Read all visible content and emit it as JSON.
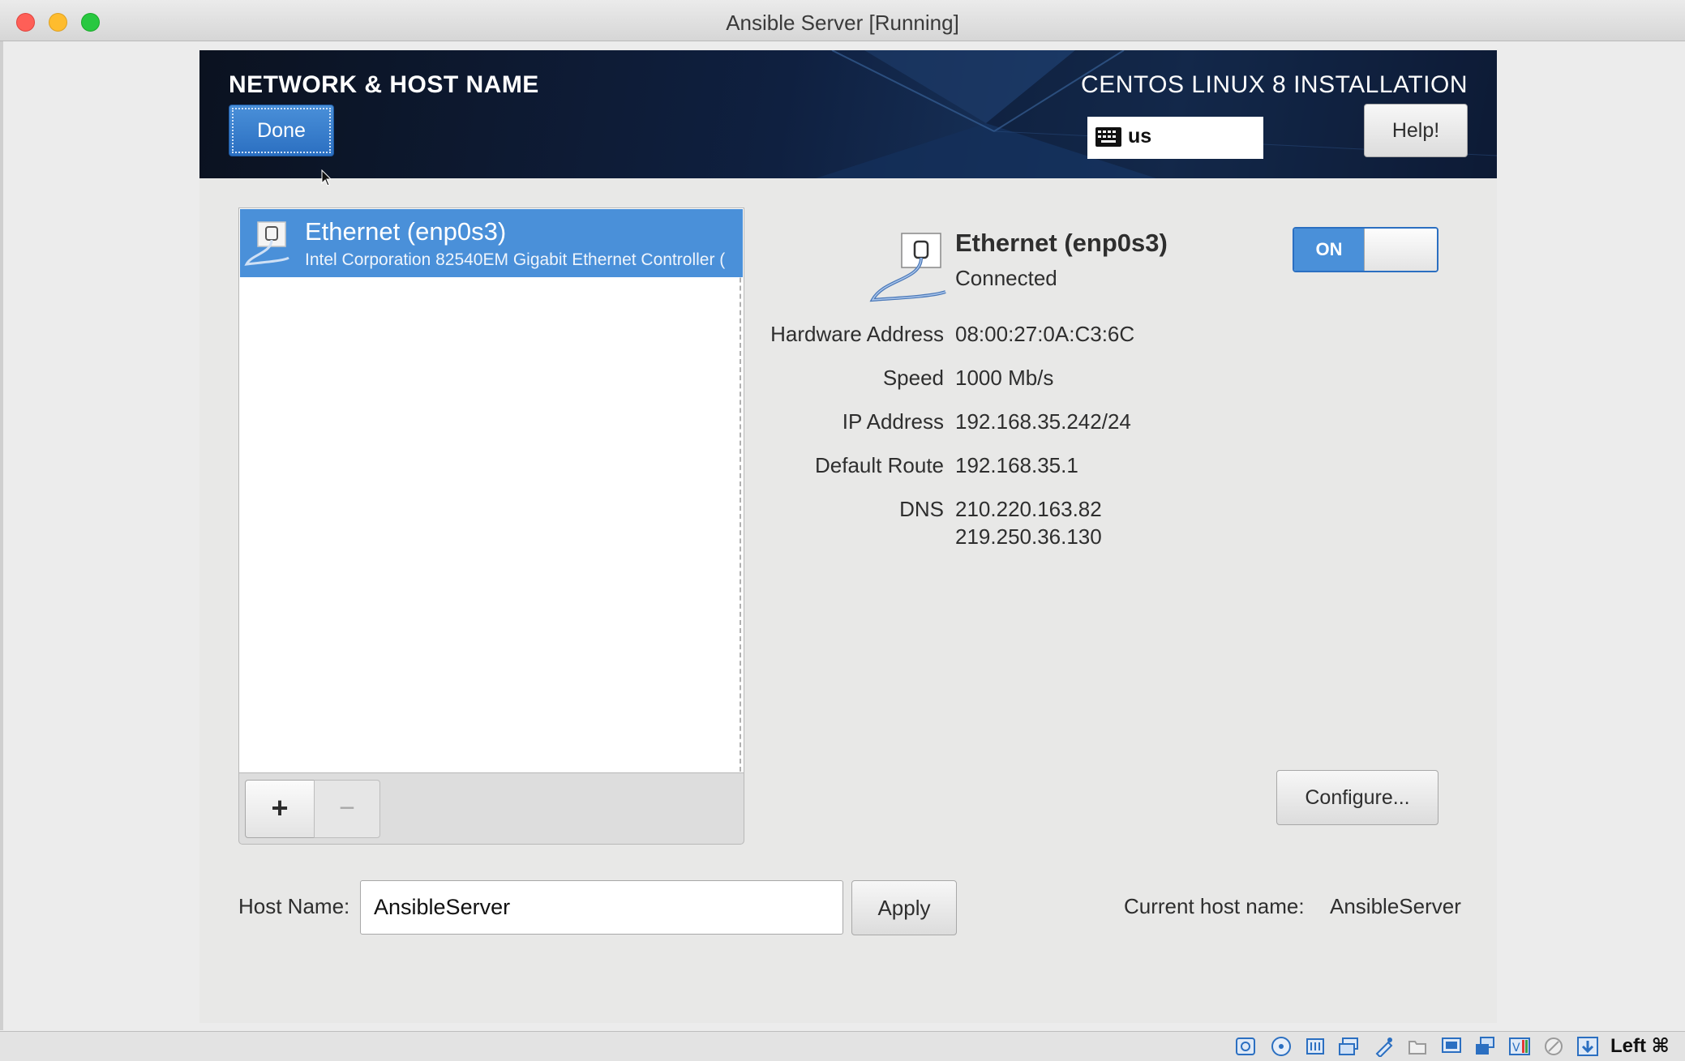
{
  "window": {
    "title": "Ansible Server [Running]"
  },
  "header": {
    "title": "NETWORK & HOST NAME",
    "product": "CENTOS LINUX 8 INSTALLATION",
    "done_label": "Done",
    "keyboard_layout": "us",
    "help_label": "Help!"
  },
  "device_list": {
    "items": [
      {
        "name": "Ethernet (enp0s3)",
        "description": "Intel Corporation 82540EM Gigabit Ethernet Controller (",
        "selected": true
      }
    ],
    "add_label": "+",
    "remove_label": "−"
  },
  "details": {
    "name": "Ethernet (enp0s3)",
    "status": "Connected",
    "toggle_label": "ON",
    "toggle_state": true,
    "rows": [
      {
        "label": "Hardware Address",
        "value": "08:00:27:0A:C3:6C"
      },
      {
        "label": "Speed",
        "value": "1000 Mb/s"
      },
      {
        "label": "IP Address",
        "value": "192.168.35.242/24"
      },
      {
        "label": "Default Route",
        "value": "192.168.35.1"
      },
      {
        "label": "DNS",
        "value": "210.220.163.82",
        "value2": "219.250.36.130"
      }
    ],
    "configure_label": "Configure..."
  },
  "hostname": {
    "label": "Host Name:",
    "value": "AnsibleServer",
    "apply_label": "Apply",
    "current_label": "Current host name:",
    "current_value": "AnsibleServer"
  },
  "statusbar": {
    "host_key": "Left ⌘"
  },
  "colors": {
    "accent": "#4a90d9",
    "header_bg": "#0f2040",
    "background": "#e8e8e7"
  }
}
